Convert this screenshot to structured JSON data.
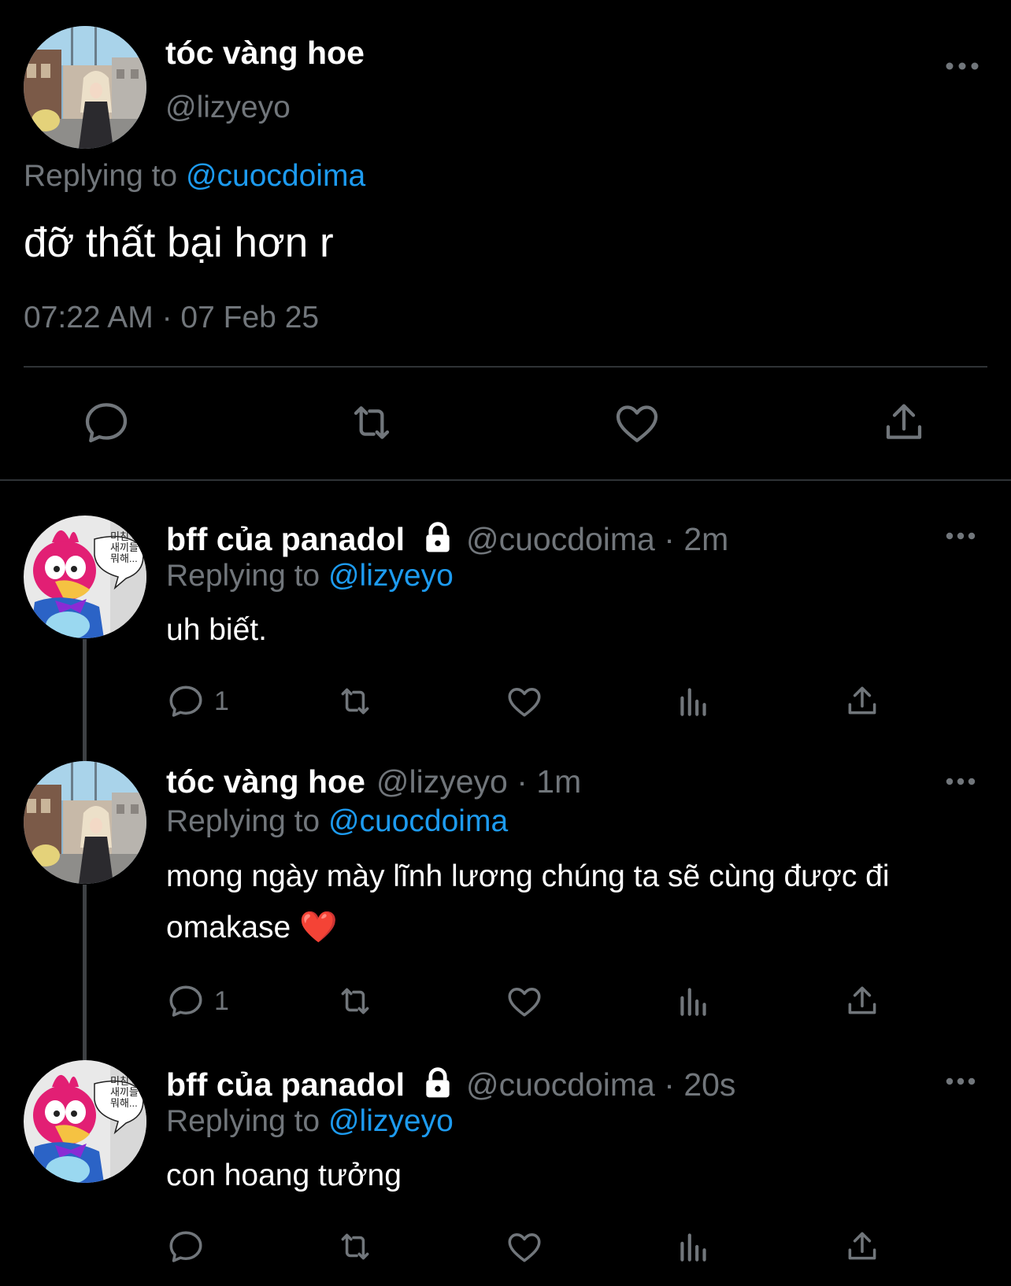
{
  "main_tweet": {
    "author_name": "tóc vàng hoe",
    "handle": "@lizyeyo",
    "replying_prefix": "Replying to ",
    "replying_to": "@cuocdoima",
    "text": "đỡ thất bại hơn r",
    "timestamp": "07:22 AM · 07 Feb 25",
    "actions": [
      "reply-icon",
      "retweet-icon",
      "like-icon",
      "share-icon"
    ]
  },
  "replies": [
    {
      "author_name": "bff của panadol",
      "handle": "@cuocdoima",
      "time": "2m",
      "replying_prefix": "Replying to ",
      "replying_to": "@lizyeyo",
      "text": "uh biết.",
      "reply_count": "1"
    },
    {
      "author_name": "tóc vàng hoe",
      "handle": "@lizyeyo",
      "time": "1m",
      "replying_prefix": "Replying to ",
      "replying_to": "@cuocdoima",
      "text": "mong ngày mày lĩnh lương chúng ta sẽ cùng được đi omakase ❤️",
      "reply_count": "1"
    },
    {
      "author_name": "bff của panadol",
      "handle": "@cuocdoima",
      "time": "20s",
      "replying_prefix": "Replying to ",
      "replying_to": "@lizyeyo",
      "text": "con hoang tưởng",
      "reply_count": ""
    }
  ],
  "avatar_badge_text": "미친 저 새끼들 뭐해...",
  "colors": {
    "background": "#000000",
    "text_primary": "#ffffff",
    "text_secondary": "#71767b",
    "link": "#1d9bf0",
    "divider": "#2f3336",
    "thread_line": "#3e4144"
  }
}
